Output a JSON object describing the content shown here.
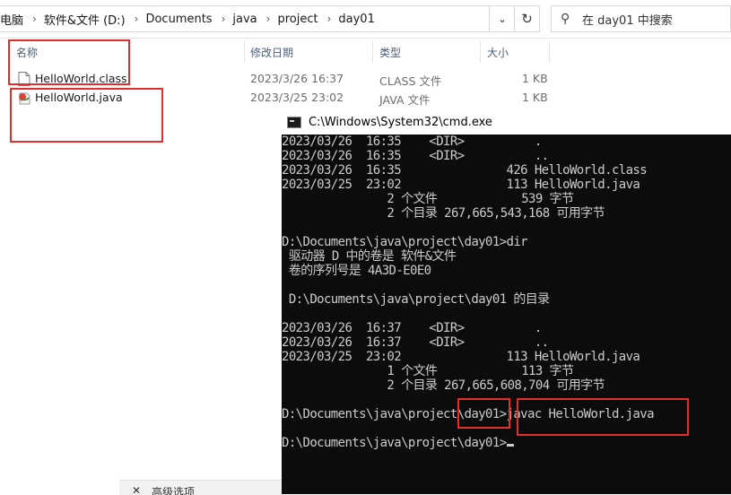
{
  "explorer": {
    "breadcrumbs": [
      "电脑",
      "软件&文件 (D:)",
      "Documents",
      "java",
      "project",
      "day01"
    ],
    "search_placeholder": "在 day01 中搜索",
    "columns": {
      "name": "名称",
      "date": "修改日期",
      "type": "类型",
      "size": "大小"
    },
    "files": [
      {
        "name": "HelloWorld.class",
        "date": "2023/3/26 16:37",
        "type": "CLASS 文件",
        "size": "1 KB"
      },
      {
        "name": "HelloWorld.java",
        "date": "2023/3/25 23:02",
        "type": "JAVA 文件",
        "size": "1 KB"
      }
    ],
    "bottom_panel_label": "高级选项"
  },
  "cmd": {
    "title": "C:\\Windows\\System32\\cmd.exe",
    "lines": [
      "2023/03/26  16:35    <DIR>          .",
      "2023/03/26  16:35    <DIR>          ..",
      "2023/03/26  16:35               426 HelloWorld.class",
      "2023/03/25  23:02               113 HelloWorld.java",
      "               2 个文件            539 字节",
      "               2 个目录 267,665,543,168 可用字节",
      "",
      "D:\\Documents\\java\\project\\day01>dir",
      " 驱动器 D 中的卷是 软件&文件",
      " 卷的序列号是 4A3D-E0E0",
      "",
      " D:\\Documents\\java\\project\\day01 的目录",
      "",
      "2023/03/26  16:37    <DIR>          .",
      "2023/03/26  16:37    <DIR>          ..",
      "2023/03/25  23:02               113 HelloWorld.java",
      "               1 个文件            113 字节",
      "               2 个目录 267,665,608,704 可用字节",
      "",
      "D:\\Documents\\java\\project\\day01>javac HelloWorld.java",
      "",
      "D:\\Documents\\java\\project\\day01>"
    ]
  },
  "colors": {
    "annotation_red": "#e32e2e",
    "console_bg": "#0c0c0c",
    "console_text": "#cccccc",
    "header_text": "#4c607a"
  }
}
